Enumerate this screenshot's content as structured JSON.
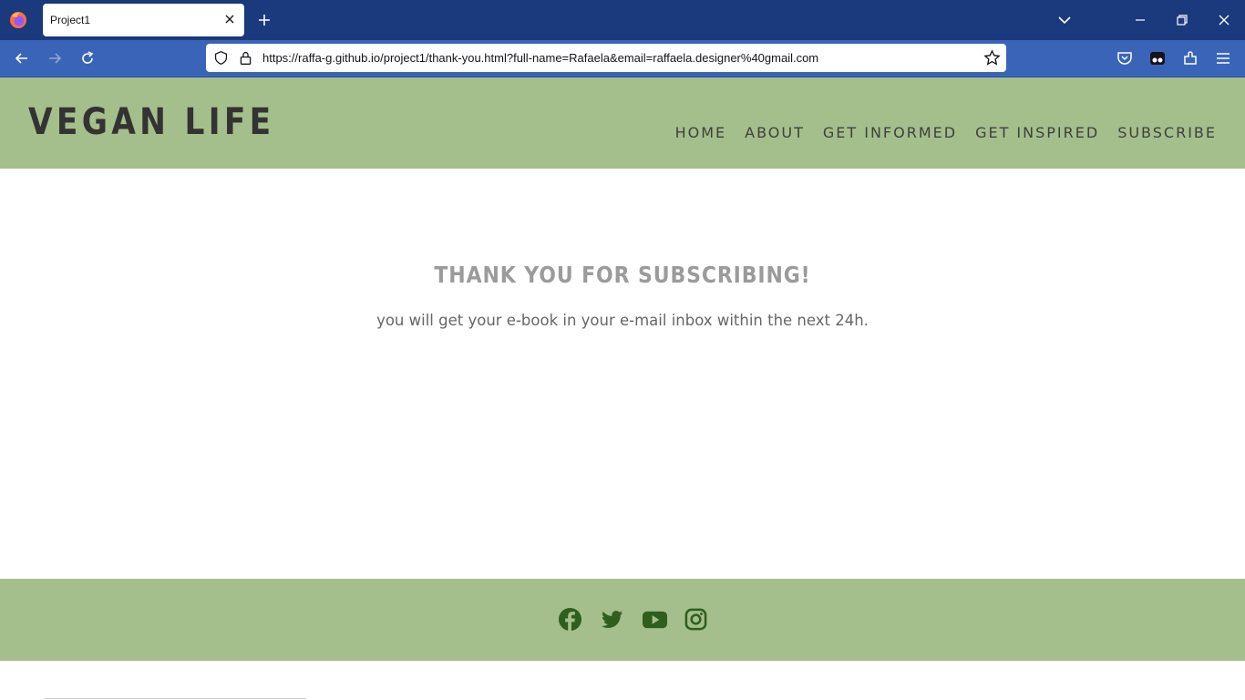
{
  "browser": {
    "tab_title": "Project1",
    "url": "https://raffa-g.github.io/project1/thank-you.html?full-name=Rafaela&email=raffaela.designer%40gmail.com"
  },
  "header": {
    "logo": "VEGAN LIFE",
    "nav": [
      "HOME",
      "ABOUT",
      "GET INFORMED",
      "GET INSPIRED",
      "SUBSCRIBE"
    ]
  },
  "main": {
    "title": "THANK YOU FOR SUBSCRIBING!",
    "subtitle": "you will get your e-book in your e-mail inbox within the next 24h."
  },
  "footer": {
    "social": [
      "facebook-icon",
      "twitter-icon",
      "youtube-icon",
      "instagram-icon"
    ]
  },
  "colors": {
    "header_bg": "#a4bf8b",
    "social_icon": "#2f5e1e",
    "browser_tabbar": "#1b3a7e",
    "browser_toolbar": "#3a64b8"
  }
}
